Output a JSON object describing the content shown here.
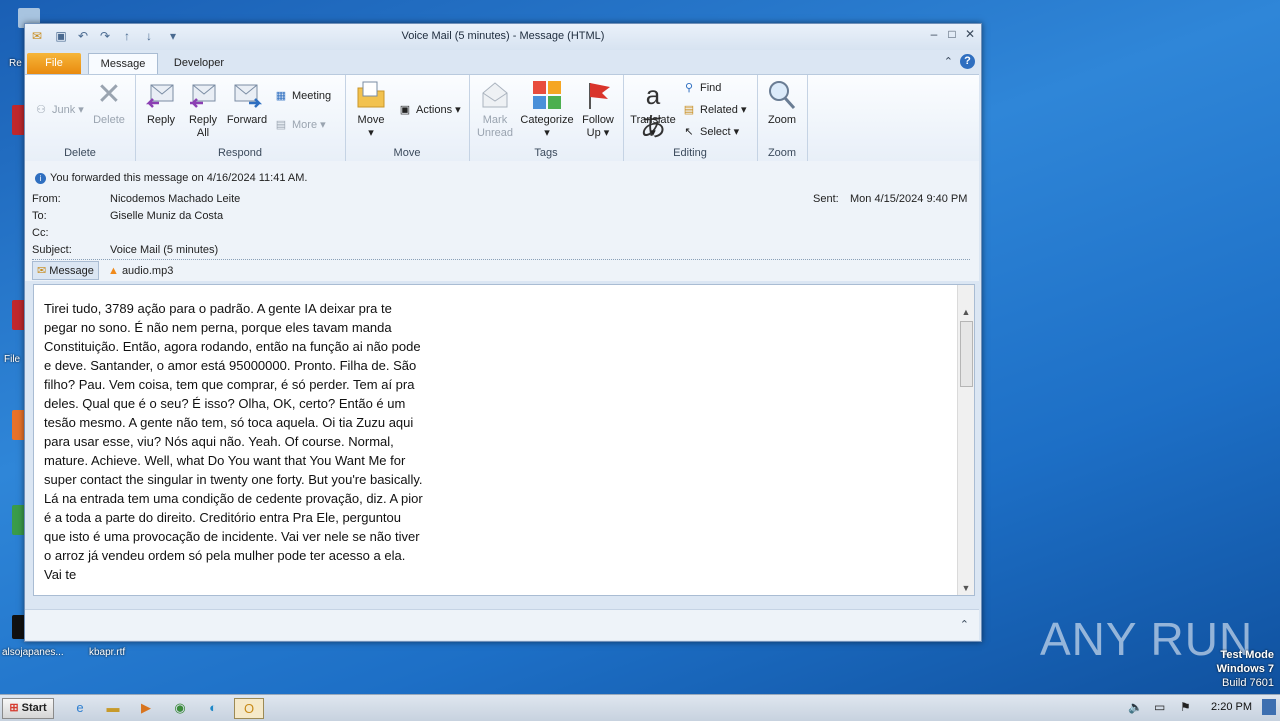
{
  "window": {
    "title": "Voice Mail (5 minutes)  -  Message (HTML)"
  },
  "tabs": {
    "file": "File",
    "message": "Message",
    "developer": "Developer"
  },
  "ribbon": {
    "delete_group": {
      "label": "Delete",
      "junk": "Junk",
      "delete": "Delete"
    },
    "respond_group": {
      "label": "Respond",
      "reply": "Reply",
      "reply_all_1": "Reply",
      "reply_all_2": "All",
      "forward": "Forward",
      "meeting": "Meeting",
      "more": "More"
    },
    "move_group": {
      "label": "Move",
      "move": "Move",
      "actions": "Actions"
    },
    "tags_group": {
      "label": "Tags",
      "mark_unread_1": "Mark",
      "mark_unread_2": "Unread",
      "categorize": "Categorize",
      "follow_up_1": "Follow",
      "follow_up_2": "Up"
    },
    "editing_group": {
      "label": "Editing",
      "translate": "Translate",
      "find": "Find",
      "related": "Related",
      "select": "Select"
    },
    "zoom_group": {
      "label": "Zoom",
      "zoom": "Zoom"
    }
  },
  "message": {
    "info_bar": "You forwarded this message on 4/16/2024 11:41 AM.",
    "from_label": "From:",
    "from": "Nicodemos Machado Leite",
    "to_label": "To:",
    "to": "Giselle Muniz da Costa",
    "cc_label": "Cc:",
    "subject_label": "Subject:",
    "subject": "Voice Mail (5 minutes)",
    "sent_label": "Sent:",
    "sent": "Mon 4/15/2024 9:40 PM",
    "tab_message": "Message",
    "attachment": "audio.mp3",
    "body": "Tirei tudo, 3789 ação para o padrão. A gente IA deixar pra te pegar no sono. É não nem perna, porque eles tavam manda Constituição. Então, agora rodando, então na função ai não pode e deve. Santander, o amor está 95000000. Pronto. Filha de. São filho? Pau. Vem coisa, tem que comprar, é só perder. Tem aí pra deles. Qual que é o seu? É isso? Olha, OK, certo? Então é um tesão mesmo. A gente não tem, só toca aquela. Oi tia Zuzu aqui para usar esse, viu? Nós aqui não. Yeah. Of course. Normal, mature. Achieve. Well, what Do You want that You Want Me for super contact the singular in twenty one forty. But you're basically. Lá na entrada tem uma condição de cedente provação, diz. A pior é a toda a parte do direito. Creditório entra Pra Ele, perguntou que isto é uma provocação de incidente. Vai ver nele se não tiver o arroz já vendeu ordem só pela mulher pode ter acesso a ela. Vai te"
  },
  "desktop": {
    "icon1": "alsojapanes...",
    "icon2": "kbapr.rtf",
    "label_re": "Re",
    "label_fil": "File"
  },
  "taskbar": {
    "start": "Start",
    "clock": "2:20 PM"
  },
  "watermark": {
    "line1": "Test Mode",
    "line2": "Windows 7",
    "line3": "Build 7601",
    "brand": "ANY RUN"
  }
}
